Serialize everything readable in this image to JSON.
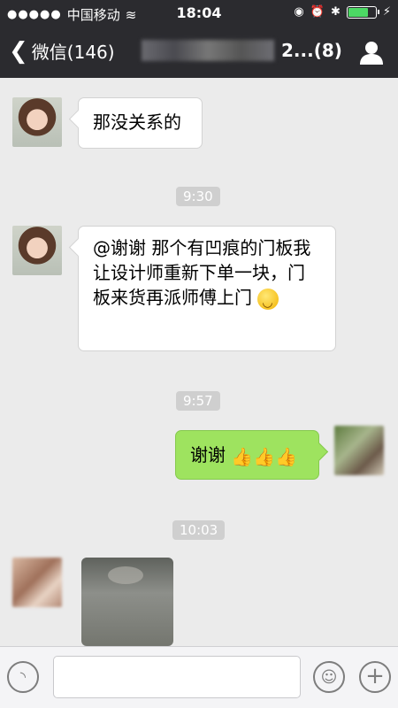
{
  "status_bar": {
    "carrier": "中国移动",
    "time": "18:04"
  },
  "nav": {
    "back_label": "微信(146)",
    "title_suffix": "2...(8)"
  },
  "messages": [
    {
      "text": "那没关系的"
    },
    {
      "timestamp": "9:30"
    },
    {
      "text": "@谢谢 那个有凹痕的门板我让设计师重新下单一块，门板来货再派师傅上门"
    },
    {
      "timestamp": "9:57"
    },
    {
      "text": "谢谢"
    },
    {
      "timestamp": "10:03"
    }
  ],
  "icons": {
    "back": "chevron-left-icon",
    "contacts": "person-icon",
    "voice": "voice-icon",
    "emoji": "emoji-icon",
    "plus": "plus-icon"
  },
  "colors": {
    "header": "#2b2b2f",
    "chat_bg": "#ebebeb",
    "sent_bubble": "#9ee35f"
  }
}
